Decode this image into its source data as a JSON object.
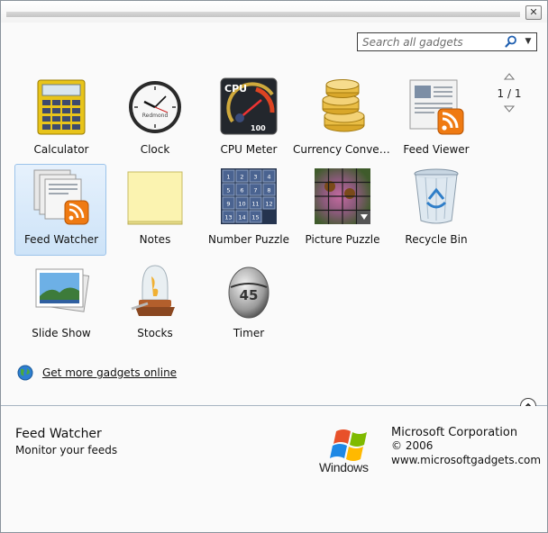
{
  "window": {
    "close_glyph": "✕"
  },
  "search": {
    "placeholder": "Search all gadgets",
    "icon": "search-icon"
  },
  "pager": {
    "label": "1 / 1"
  },
  "gadgets": [
    {
      "label": "Calculator",
      "icon": "calculator-icon"
    },
    {
      "label": "Clock",
      "icon": "clock-icon",
      "clock_brand": "Redmond"
    },
    {
      "label": "CPU Meter",
      "icon": "cpu-meter-icon",
      "meter_text": "CPU",
      "meter_value": "100"
    },
    {
      "label": "Currency Convers...",
      "icon": "currency-icon"
    },
    {
      "label": "Feed Viewer",
      "icon": "feed-viewer-icon"
    },
    {
      "label": "Feed Watcher",
      "icon": "feed-watcher-icon",
      "selected": true
    },
    {
      "label": "Notes",
      "icon": "notes-icon"
    },
    {
      "label": "Number Puzzle",
      "icon": "number-puzzle-icon",
      "tiles": [
        "1",
        "2",
        "3",
        "4",
        "5",
        "6",
        "7",
        "8",
        "9",
        "10",
        "11",
        "12",
        "13",
        "14",
        "15"
      ]
    },
    {
      "label": "Picture Puzzle",
      "icon": "picture-puzzle-icon"
    },
    {
      "label": "Recycle Bin",
      "icon": "recycle-bin-icon"
    },
    {
      "label": "Slide Show",
      "icon": "slide-show-icon"
    },
    {
      "label": "Stocks",
      "icon": "stocks-icon"
    },
    {
      "label": "Timer",
      "icon": "timer-icon",
      "timer_value": "45"
    }
  ],
  "more_link": {
    "label": "Get more gadgets online",
    "icon": "globe-icon"
  },
  "details": {
    "title": "Feed Watcher",
    "description": "Monitor your feeds",
    "logo_text": "Windows",
    "publisher": "Microsoft Corporation",
    "copyright": "© 2006",
    "website": "www.microsoftgadgets.com"
  },
  "colors": {
    "selection_border": "#9cc3ea",
    "selection_fill": "#d7e9fa",
    "divider": "#a7b4c2"
  }
}
